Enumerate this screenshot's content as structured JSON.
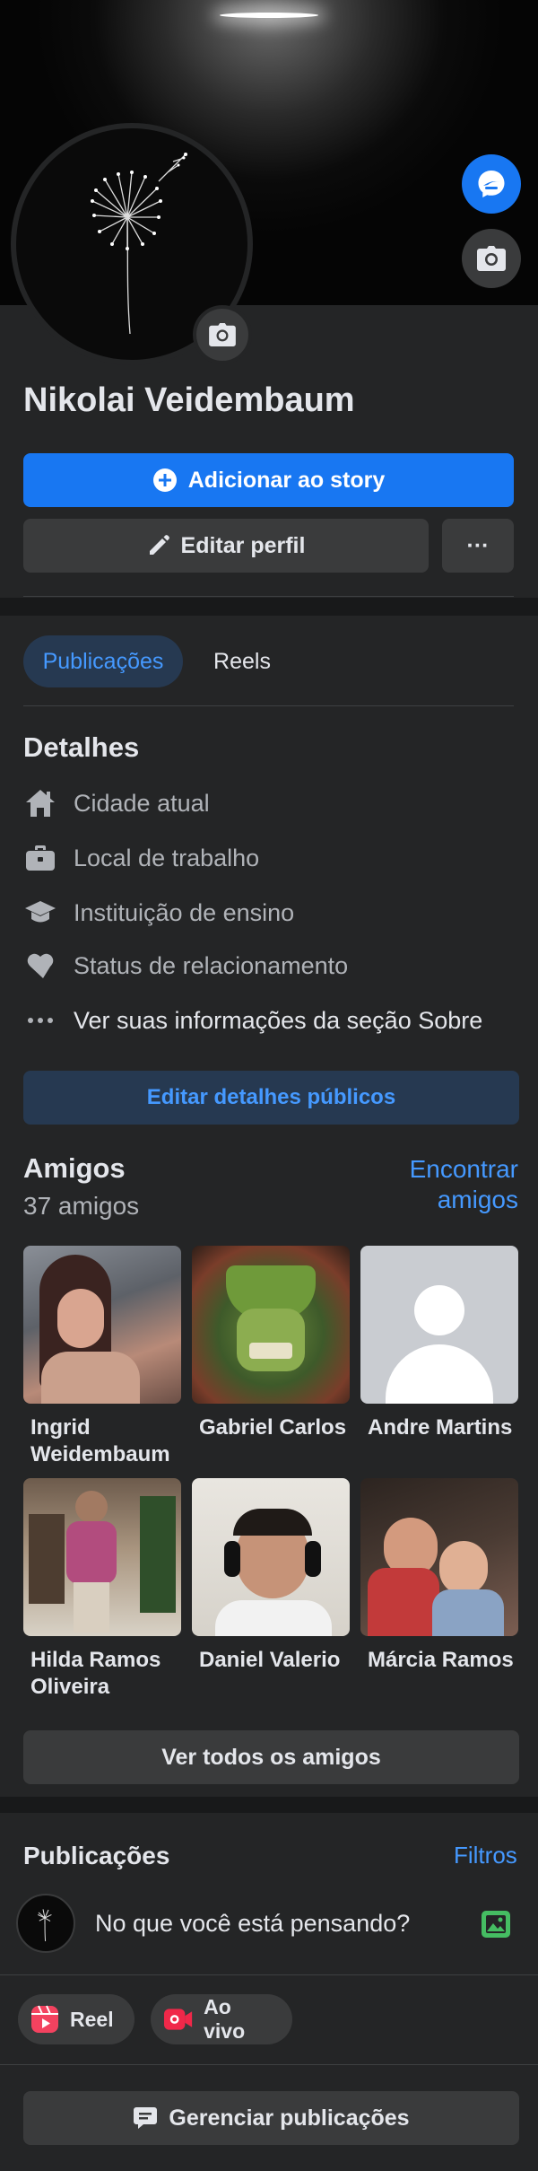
{
  "profile": {
    "name": "Nikolai Veidembaum"
  },
  "actions": {
    "add_story": "Adicionar ao story",
    "edit_profile": "Editar perfil",
    "more": "···"
  },
  "tabs": [
    {
      "label": "Publicações",
      "active": true
    },
    {
      "label": "Reels",
      "active": false
    }
  ],
  "details": {
    "title": "Detalhes",
    "items": [
      {
        "label": "Cidade atual",
        "icon": "home-icon"
      },
      {
        "label": "Local de trabalho",
        "icon": "briefcase-icon"
      },
      {
        "label": "Instituição de ensino",
        "icon": "graduation-cap-icon"
      },
      {
        "label": "Status de relacionamento",
        "icon": "heart-icon"
      },
      {
        "label": "Ver suas informações da seção Sobre",
        "icon": "ellipsis-icon"
      }
    ],
    "edit_button": "Editar detalhes públicos"
  },
  "friends": {
    "title": "Amigos",
    "count": "37 amigos",
    "find": "Encontrar amigos",
    "list": [
      {
        "name": "Ingrid Weidembaum"
      },
      {
        "name": "Gabriel Carlos"
      },
      {
        "name": "Andre Martins"
      },
      {
        "name": "Hilda Ramos Oliveira"
      },
      {
        "name": "Daniel Valerio"
      },
      {
        "name": "Márcia Ramos"
      }
    ],
    "see_all": "Ver todos os amigos"
  },
  "posts": {
    "title": "Publicações",
    "filters": "Filtros",
    "composer_placeholder": "No que você está pensando?",
    "reel": "Reel",
    "live": "Ao vivo",
    "manage": "Gerenciar publicações"
  },
  "colors": {
    "background": "#242526",
    "accent": "#1877f2",
    "link": "#4599ff",
    "button_gray": "#3a3b3c",
    "text": "#e4e6eb",
    "muted": "#b0b3b8"
  }
}
